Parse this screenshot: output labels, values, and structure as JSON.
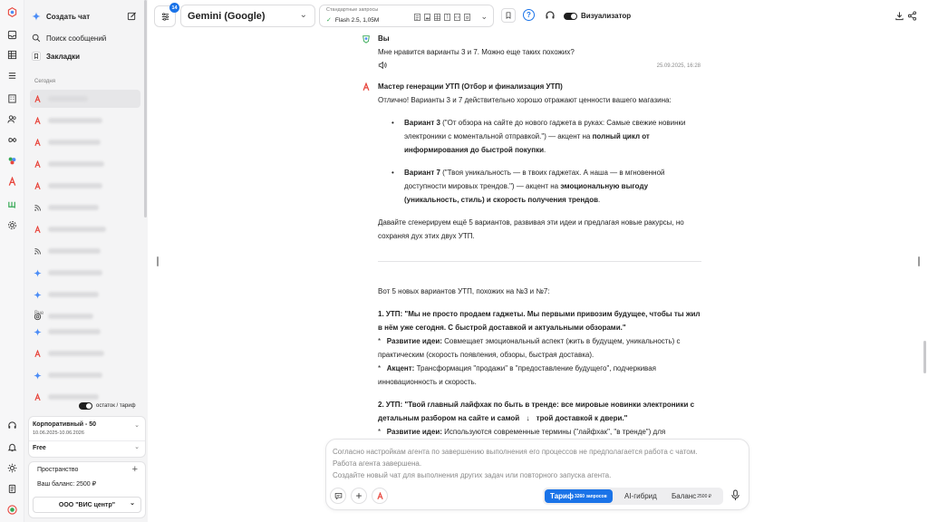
{
  "sidebar": {
    "new_chat_label": "Создать чат",
    "search_label": "Поиск сообщений",
    "bookmarks_label": "Закладки",
    "section_today": "Сегодня",
    "section_earlier": "Вче",
    "history_today_icons": [
      "a-icon",
      "a-icon",
      "a-icon",
      "a-icon",
      "a-icon",
      "feed-icon",
      "a-icon",
      "feed-icon",
      "sparkle-icon",
      "sparkle-icon",
      "openai-icon"
    ],
    "history_earlier_icons": [
      "sparkle-icon",
      "a-icon",
      "sparkle-icon",
      "a-icon"
    ],
    "remaining_label": "остаток / тариф",
    "plan_name": "Корпоративный - 50",
    "plan_dates": "10.06.2025-10.06.2026",
    "plan_tier": "Free",
    "space_label": "Пространство",
    "balance_label": "Ваш баланс: 2500 ₽",
    "org_name": "ООО \"ВИС центр\""
  },
  "topbar": {
    "notifications_badge": "14",
    "model_name": "Gemini (Google)",
    "requests_title": "Стандартные запросы",
    "requests_value": "Flash 2.5, 1,05M",
    "visualizer_label": "Визуализатор"
  },
  "messages": {
    "user_name": "Вы",
    "user_text": "Мне нравится варианты 3 и 7. Можно еще таких похожих?",
    "user_time": "25.09.2025, 16:28",
    "bot_name": "Мастер генерации УТП (Отбор и финализация УТП)",
    "bot_intro": "Отлично! Варианты 3 и 7 действительно хорошо отражают ценности вашего магазина:",
    "v3_label": "Вариант 3",
    "v3_text": " (\"От обзора на сайте до нового гаджета в руках: Самые свежие новинки электроники с моментальной отправкой.\") — акцент на ",
    "v3_bold": "полный цикл от информирования до быстрой покупки",
    "v7_label": "Вариант 7",
    "v7_text": " (\"Твоя уникальность — в твоих гаджетах. А наша — в мгновенной доступности мировых трендов.\") — акцент на ",
    "v7_bold": "эмоциональную выгоду (уникальность, стиль) и скорость получения трендов",
    "bot_outro": "Давайте сгенерируем ещё 5 вариантов, развивая эти идеи и предлагая новые ракурсы, но сохраняя дух этих двух УТП.",
    "new_intro": "Вот 5 новых вариантов УТП, похожих на №3 и №7:",
    "utp1_title": "1. УТП: \"Мы не просто продаем гаджеты. Мы первыми привозим будущее, чтобы ты жил в нём уже сегодня. С быстрой доставкой и актуальными обзорами.\"",
    "utp1_dev_label": "Развитие идеи:",
    "utp1_dev_text": " Совмещает эмоциональный аспект (жить в будущем, уникальность) с практическим (скорость появления, обзоры, быстрая доставка).",
    "utp1_acc_label": "Акцент:",
    "utp1_acc_text": " Трансформация \"продажи\" в \"предоставление будущего\", подчеркивая инновационность и скорость.",
    "utp2_title_a": "2. УТП: \"Твой главный лайфхак по быть в тренде: все мировые новинки электроники с детальным разбором на сайте и самой ",
    "utp2_title_b": " трой доставкой к двери.\"",
    "utp2_dev_label": "Развитие идеи:",
    "utp2_dev_text": " Используются современные термины (\"лайфхак\", \"в тренде\") для"
  },
  "composer": {
    "line1": "Согласно настройкам агента по завершению выполнения его процессов не предполагается работа с чатом.",
    "line2": "Работа агента завершена.",
    "line3": "Создайте новый чат для выполнения других задач или повторного запуска агента.",
    "tariff_label": "Тариф",
    "tariff_sup": "3260 запросов",
    "hybrid_label": "AI-гибрид",
    "balance_label": "Баланс",
    "balance_sup": "2500 ₽"
  },
  "colors": {
    "accent_blue": "#1a73e8",
    "brand_red": "#e8453c",
    "gemini_blue": "#4c8df6",
    "text": "#1f1f1f"
  }
}
